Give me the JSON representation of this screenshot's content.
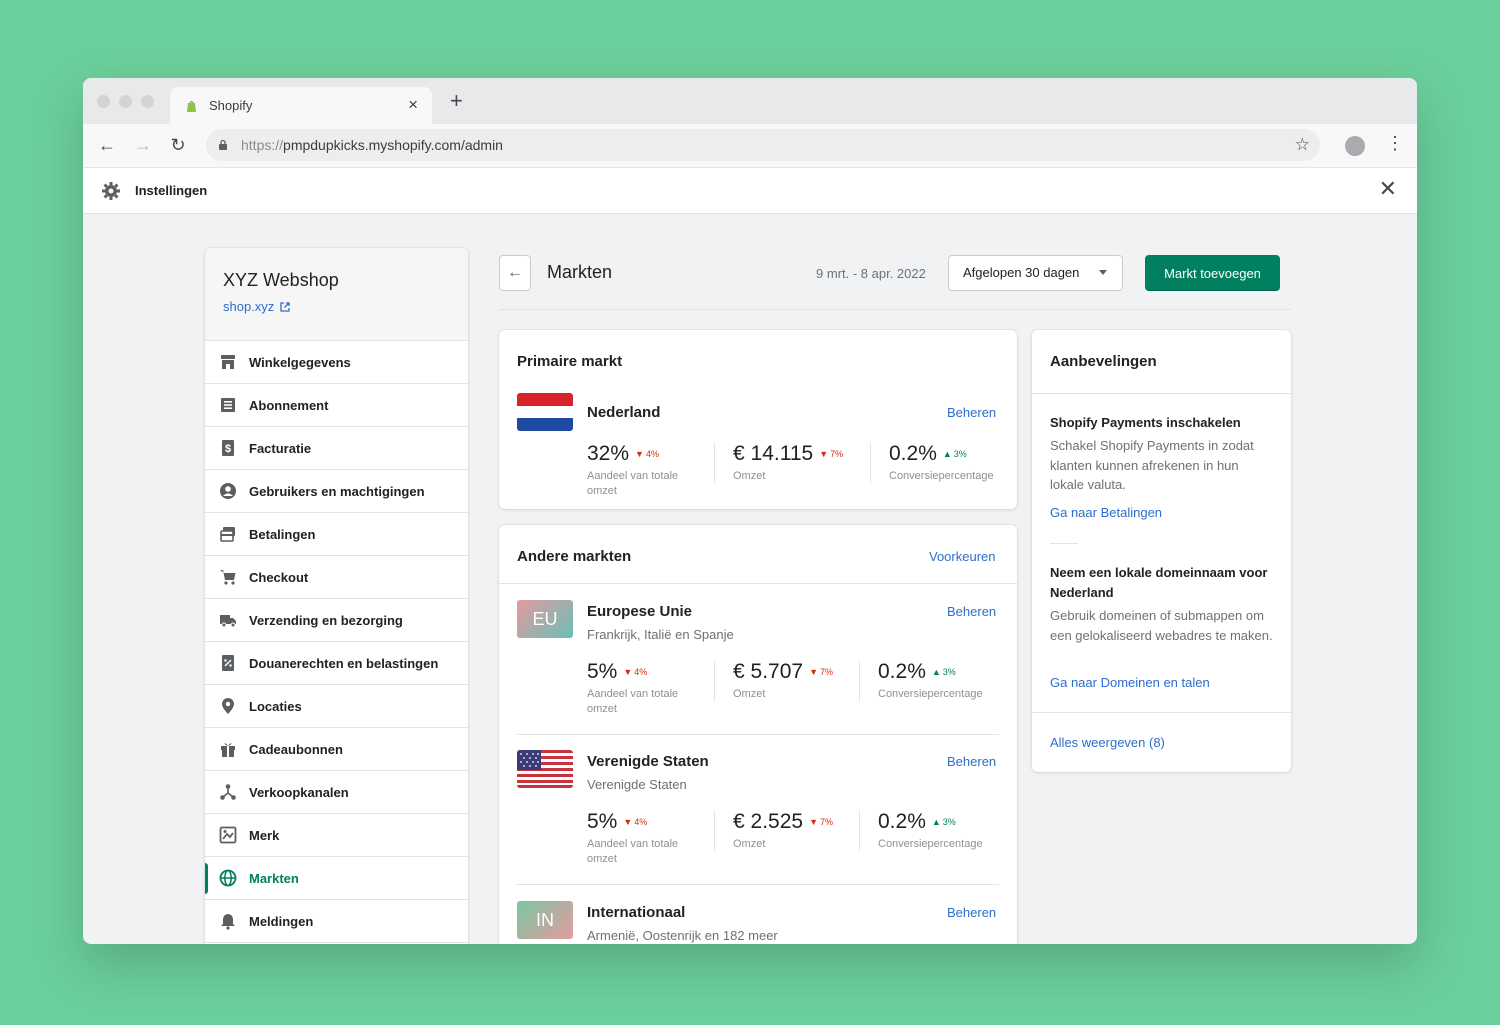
{
  "browser": {
    "tab_title": "Shopify",
    "url_scheme": "https://",
    "url_rest": "pmpdupkicks.myshopify.com/admin"
  },
  "settings": {
    "title": "Instellingen"
  },
  "sidebar": {
    "store_name": "XYZ Webshop",
    "store_link": "shop.xyz",
    "items": [
      {
        "label": "Winkelgegevens",
        "icon": "store-icon"
      },
      {
        "label": "Abonnement",
        "icon": "list-icon"
      },
      {
        "label": "Facturatie",
        "icon": "dollar-icon"
      },
      {
        "label": "Gebruikers en machtigingen",
        "icon": "user-icon"
      },
      {
        "label": "Betalingen",
        "icon": "card-icon"
      },
      {
        "label": "Checkout",
        "icon": "cart-icon"
      },
      {
        "label": "Verzending en bezorging",
        "icon": "truck-icon"
      },
      {
        "label": "Douanerechten en belastingen",
        "icon": "tax-icon"
      },
      {
        "label": "Locaties",
        "icon": "location-icon"
      },
      {
        "label": "Cadeaubonnen",
        "icon": "gift-icon"
      },
      {
        "label": "Verkoopkanalen",
        "icon": "channels-icon"
      },
      {
        "label": "Merk",
        "icon": "brand-icon"
      },
      {
        "label": "Markten",
        "icon": "globe-icon",
        "active": true
      },
      {
        "label": "Meldingen",
        "icon": "bell-icon"
      }
    ]
  },
  "header": {
    "title": "Markten",
    "date_range": "9 mrt. - 8 apr. 2022",
    "range_select": "Afgelopen 30 dagen",
    "add_button": "Markt toevoegen"
  },
  "primary": {
    "title": "Primaire markt",
    "market": {
      "name": "Nederland",
      "manage": "Beheren",
      "share": "32%",
      "share_chg": "4%",
      "share_label": "Aandeel van totale omzet",
      "revenue": "€ 14.115",
      "revenue_chg": "7%",
      "revenue_label": "Omzet",
      "conv": "0.2%",
      "conv_chg": "3%",
      "conv_label": "Conversiepercentage"
    }
  },
  "others": {
    "title": "Andere markten",
    "prefs": "Voorkeuren",
    "markets": [
      {
        "badge": "EU",
        "name": "Europese Unie",
        "sub": "Frankrijk, Italië en Spanje",
        "manage": "Beheren",
        "share": "5%",
        "share_chg": "4%",
        "share_label": "Aandeel van totale omzet",
        "revenue": "€ 5.707",
        "revenue_chg": "7%",
        "revenue_label": "Omzet",
        "conv": "0.2%",
        "conv_chg": "3%",
        "conv_label": "Conversiepercentage"
      },
      {
        "name": "Verenigde Staten",
        "sub": "Verenigde Staten",
        "manage": "Beheren",
        "share": "5%",
        "share_chg": "4%",
        "share_label": "Aandeel van totale omzet",
        "revenue": "€ 2.525",
        "revenue_chg": "7%",
        "revenue_label": "Omzet",
        "conv": "0.2%",
        "conv_chg": "3%",
        "conv_label": "Conversiepercentage"
      },
      {
        "badge": "IN",
        "name": "Internationaal",
        "sub": "Armenië, Oostenrijk en 182 meer",
        "manage": "Beheren"
      }
    ]
  },
  "recommendations": {
    "title": "Aanbevelingen",
    "items": [
      {
        "title": "Shopify Payments inschakelen",
        "body": "Schakel Shopify Payments in zodat klanten kunnen afrekenen in hun lokale valuta.",
        "link": "Ga naar Betalingen"
      },
      {
        "title": "Neem een lokale domeinnaam voor Nederland",
        "body": "Gebruik domeinen of submappen om een gelokaliseerd webadres te maken.",
        "link": "Ga naar Domeinen en talen"
      }
    ],
    "all_link": "Alles weergeven (8)"
  },
  "colors": {
    "accent": "#008060",
    "link": "#2c6ecb",
    "down": "#d72c0d",
    "background": "#6bcf9b"
  }
}
